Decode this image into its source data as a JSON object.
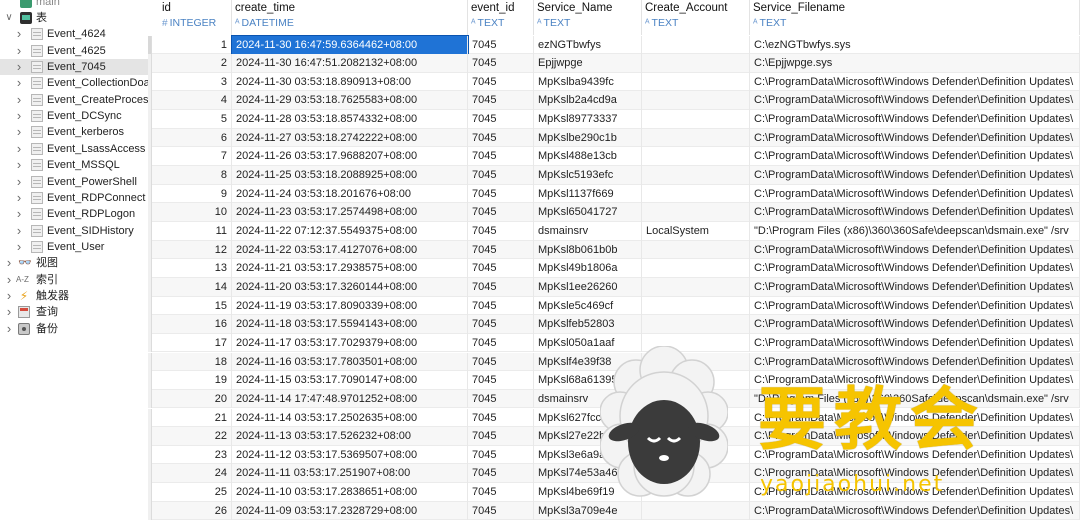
{
  "sidebar": {
    "partial_top": "main",
    "table_group_label": "表",
    "tables": [
      {
        "label": "Event_4624",
        "selected": false
      },
      {
        "label": "Event_4625",
        "selected": false
      },
      {
        "label": "Event_7045",
        "selected": true
      },
      {
        "label": "Event_CollectionDoa",
        "selected": false
      },
      {
        "label": "Event_CreateProcess",
        "selected": false
      },
      {
        "label": "Event_DCSync",
        "selected": false
      },
      {
        "label": "Event_kerberos",
        "selected": false
      },
      {
        "label": "Event_LsassAccess",
        "selected": false
      },
      {
        "label": "Event_MSSQL",
        "selected": false
      },
      {
        "label": "Event_PowerShell",
        "selected": false
      },
      {
        "label": "Event_RDPConnect",
        "selected": false
      },
      {
        "label": "Event_RDPLogon",
        "selected": false
      },
      {
        "label": "Event_SIDHistory",
        "selected": false
      },
      {
        "label": "Event_User",
        "selected": false
      }
    ],
    "groups": [
      {
        "label": "视图",
        "icon": "view-icon"
      },
      {
        "label": "索引",
        "icon": "index-icon"
      },
      {
        "label": "触发器",
        "icon": "trigger-icon"
      },
      {
        "label": "查询",
        "icon": "query-icon"
      },
      {
        "label": "备份",
        "icon": "backup-icon"
      }
    ],
    "index_icon_text": "A-Z"
  },
  "grid": {
    "columns": [
      {
        "name": "id",
        "type": "INTEGER",
        "type_icon": "#"
      },
      {
        "name": "create_time",
        "type": "DATETIME",
        "type_icon": "ᴬ"
      },
      {
        "name": "event_id",
        "type": "TEXT",
        "type_icon": "ᴬ"
      },
      {
        "name": "Service_Name",
        "type": "TEXT",
        "type_icon": "ᴬ"
      },
      {
        "name": "Create_Account",
        "type": "TEXT",
        "type_icon": "ᴬ"
      },
      {
        "name": "Service_Filename",
        "type": "TEXT",
        "type_icon": "ᴬ"
      }
    ],
    "rows": [
      [
        "1",
        "2024-11-30 16:47:59.6364462+08:00",
        "7045",
        "ezNGTbwfys",
        "",
        "C:\\ezNGTbwfys.sys"
      ],
      [
        "2",
        "2024-11-30 16:47:51.2082132+08:00",
        "7045",
        "Epjjwpge",
        "",
        "C:\\Epjjwpge.sys"
      ],
      [
        "3",
        "2024-11-30 03:53:18.890913+08:00",
        "7045",
        "MpKslba9439fc",
        "",
        "C:\\ProgramData\\Microsoft\\Windows Defender\\Definition Updates\\"
      ],
      [
        "4",
        "2024-11-29 03:53:18.7625583+08:00",
        "7045",
        "MpKslb2a4cd9a",
        "",
        "C:\\ProgramData\\Microsoft\\Windows Defender\\Definition Updates\\"
      ],
      [
        "5",
        "2024-11-28 03:53:18.8574332+08:00",
        "7045",
        "MpKsl89773337",
        "",
        "C:\\ProgramData\\Microsoft\\Windows Defender\\Definition Updates\\"
      ],
      [
        "6",
        "2024-11-27 03:53:18.2742222+08:00",
        "7045",
        "MpKslbe290c1b",
        "",
        "C:\\ProgramData\\Microsoft\\Windows Defender\\Definition Updates\\"
      ],
      [
        "7",
        "2024-11-26 03:53:17.9688207+08:00",
        "7045",
        "MpKsl488e13cb",
        "",
        "C:\\ProgramData\\Microsoft\\Windows Defender\\Definition Updates\\"
      ],
      [
        "8",
        "2024-11-25 03:53:18.2088925+08:00",
        "7045",
        "MpKslc5193efc",
        "",
        "C:\\ProgramData\\Microsoft\\Windows Defender\\Definition Updates\\"
      ],
      [
        "9",
        "2024-11-24 03:53:18.201676+08:00",
        "7045",
        "MpKsl1137f669",
        "",
        "C:\\ProgramData\\Microsoft\\Windows Defender\\Definition Updates\\"
      ],
      [
        "10",
        "2024-11-23 03:53:17.2574498+08:00",
        "7045",
        "MpKsl65041727",
        "",
        "C:\\ProgramData\\Microsoft\\Windows Defender\\Definition Updates\\"
      ],
      [
        "11",
        "2024-11-22 07:12:37.5549375+08:00",
        "7045",
        "dsmainsrv",
        "LocalSystem",
        "\"D:\\Program Files (x86)\\360\\360Safe\\deepscan\\dsmain.exe\" /srv"
      ],
      [
        "12",
        "2024-11-22 03:53:17.4127076+08:00",
        "7045",
        "MpKsl8b061b0b",
        "",
        "C:\\ProgramData\\Microsoft\\Windows Defender\\Definition Updates\\"
      ],
      [
        "13",
        "2024-11-21 03:53:17.2938575+08:00",
        "7045",
        "MpKsl49b1806a",
        "",
        "C:\\ProgramData\\Microsoft\\Windows Defender\\Definition Updates\\"
      ],
      [
        "14",
        "2024-11-20 03:53:17.3260144+08:00",
        "7045",
        "MpKsl1ee26260",
        "",
        "C:\\ProgramData\\Microsoft\\Windows Defender\\Definition Updates\\"
      ],
      [
        "15",
        "2024-11-19 03:53:17.8090339+08:00",
        "7045",
        "MpKsle5c469cf",
        "",
        "C:\\ProgramData\\Microsoft\\Windows Defender\\Definition Updates\\"
      ],
      [
        "16",
        "2024-11-18 03:53:17.5594143+08:00",
        "7045",
        "MpKslfeb52803",
        "",
        "C:\\ProgramData\\Microsoft\\Windows Defender\\Definition Updates\\"
      ],
      [
        "17",
        "2024-11-17 03:53:17.7029379+08:00",
        "7045",
        "MpKsl050a1aaf",
        "",
        "C:\\ProgramData\\Microsoft\\Windows Defender\\Definition Updates\\"
      ],
      [
        "18",
        "2024-11-16 03:53:17.7803501+08:00",
        "7045",
        "MpKslf4e39f38",
        "",
        "C:\\ProgramData\\Microsoft\\Windows Defender\\Definition Updates\\"
      ],
      [
        "19",
        "2024-11-15 03:53:17.7090147+08:00",
        "7045",
        "MpKsl68a61395",
        "",
        "C:\\ProgramData\\Microsoft\\Windows Defender\\Definition Updates\\"
      ],
      [
        "20",
        "2024-11-14 17:47:48.9701252+08:00",
        "7045",
        "dsmainsrv",
        "LocalSystem",
        "\"D:\\Program Files (x86)\\360\\360Safe\\deepscan\\dsmain.exe\" /srv"
      ],
      [
        "21",
        "2024-11-14 03:53:17.2502635+08:00",
        "7045",
        "MpKsl627fcc0",
        "",
        "C:\\ProgramData\\Microsoft\\Windows Defender\\Definition Updates\\"
      ],
      [
        "22",
        "2024-11-13 03:53:17.526232+08:00",
        "7045",
        "MpKsl27e22b5",
        "",
        "C:\\ProgramData\\Microsoft\\Windows Defender\\Definition Updates\\"
      ],
      [
        "23",
        "2024-11-12 03:53:17.5369507+08:00",
        "7045",
        "MpKsl3e6a9af9",
        "",
        "C:\\ProgramData\\Microsoft\\Windows Defender\\Definition Updates\\"
      ],
      [
        "24",
        "2024-11-11 03:53:17.251907+08:00",
        "7045",
        "MpKsl74e53a46",
        "",
        "C:\\ProgramData\\Microsoft\\Windows Defender\\Definition Updates\\"
      ],
      [
        "25",
        "2024-11-10 03:53:17.2838651+08:00",
        "7045",
        "MpKsl4be69f19",
        "",
        "C:\\ProgramData\\Microsoft\\Windows Defender\\Definition Updates\\"
      ],
      [
        "26",
        "2024-11-09 03:53:17.2328729+08:00",
        "7045",
        "MpKsl3a709e4e",
        "",
        "C:\\ProgramData\\Microsoft\\Windows Defender\\Definition Updates\\"
      ]
    ],
    "selected_cell": {
      "row": 0,
      "col": 1
    }
  },
  "watermark": {
    "title": "要教会",
    "url": "yaojiaohui.net",
    "color": "#f6c400"
  },
  "colors": {
    "selection": "#1f73d6",
    "type_label": "#4a82c3"
  }
}
